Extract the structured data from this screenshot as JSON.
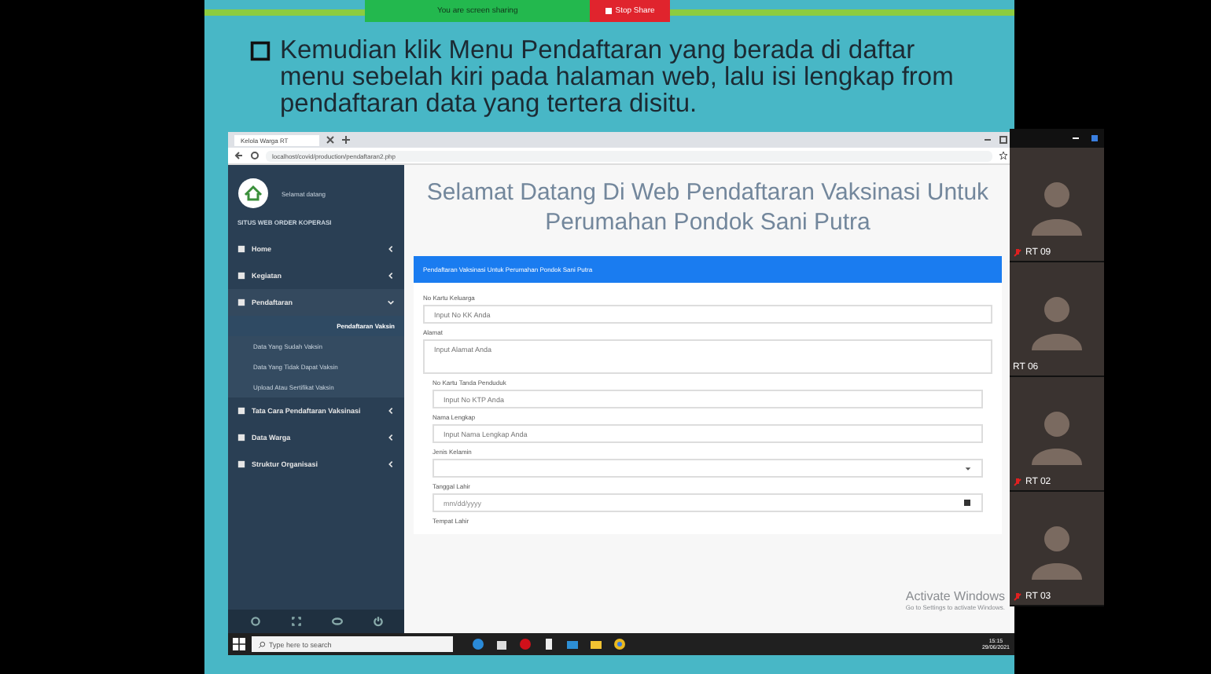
{
  "share_bar": {
    "status": "You are screen sharing",
    "stop_button": "Stop Share"
  },
  "slide": {
    "instruction": "Kemudian klik Menu Pendaftaran yang berada di daftar menu sebelah kiri pada halaman web, lalu isi lengkap from pendaftaran data yang tertera disitu."
  },
  "browser": {
    "tab_title": "Kelola Warga RT",
    "url": "localhost/covid/production/pendaftaran2.php",
    "sidebar": {
      "greeting": "Selamat datang",
      "site_name": "SITUS WEB ORDER KOPERASI",
      "items": [
        {
          "label": "Home",
          "expanded": false
        },
        {
          "label": "Kegiatan",
          "expanded": false
        },
        {
          "label": "Pendaftaran",
          "expanded": true,
          "children": [
            {
              "label": "Pendaftaran Vaksin",
              "selected": true
            },
            {
              "label": "Data Yang Sudah Vaksin",
              "selected": false
            },
            {
              "label": "Data Yang Tidak Dapat Vaksin",
              "selected": false
            },
            {
              "label": "Upload Atau Sertifikat Vaksin",
              "selected": false
            }
          ]
        },
        {
          "label": "Tata Cara Pendaftaran Vaksinasi",
          "expanded": false
        },
        {
          "label": "Data Warga",
          "expanded": false
        },
        {
          "label": "Struktur Organisasi",
          "expanded": false
        }
      ]
    },
    "heading": "Selamat Datang Di Web Pendaftaran Vaksinasi Untuk Perumahan Pondok Sani Putra",
    "form_title": "Pendaftaran Vaksinasi Untuk Perumahan Pondok Sani Putra",
    "fields": [
      {
        "kind": "input",
        "label": "No Kartu Keluarga",
        "placeholder": "Input No KK Anda"
      },
      {
        "kind": "textarea",
        "label": "Alamat",
        "placeholder": "Input Alamat Anda"
      },
      {
        "kind": "input",
        "label": "No Kartu Tanda Penduduk",
        "placeholder": "Input No KTP Anda"
      },
      {
        "kind": "input",
        "label": "Nama Lengkap",
        "placeholder": "Input Nama Lengkap Anda"
      },
      {
        "kind": "select",
        "label": "Jenis Kelamin"
      },
      {
        "kind": "date",
        "label": "Tanggal Lahir",
        "placeholder": "mm/dd/yyyy"
      },
      {
        "kind": "label",
        "label": "Tempat Lahir"
      }
    ]
  },
  "os_notice": {
    "title": "Activate Windows",
    "subtitle": "Go to Settings to activate Windows."
  },
  "taskbar": {
    "search_placeholder": "Type here to search",
    "time": "15:15",
    "date": "29/06/2021"
  },
  "participants": [
    {
      "label": "RT 09",
      "muted": true
    },
    {
      "label": "RT 06",
      "muted": false
    },
    {
      "label": "RT 02",
      "muted": true
    },
    {
      "label": "RT 03",
      "muted": true
    }
  ]
}
